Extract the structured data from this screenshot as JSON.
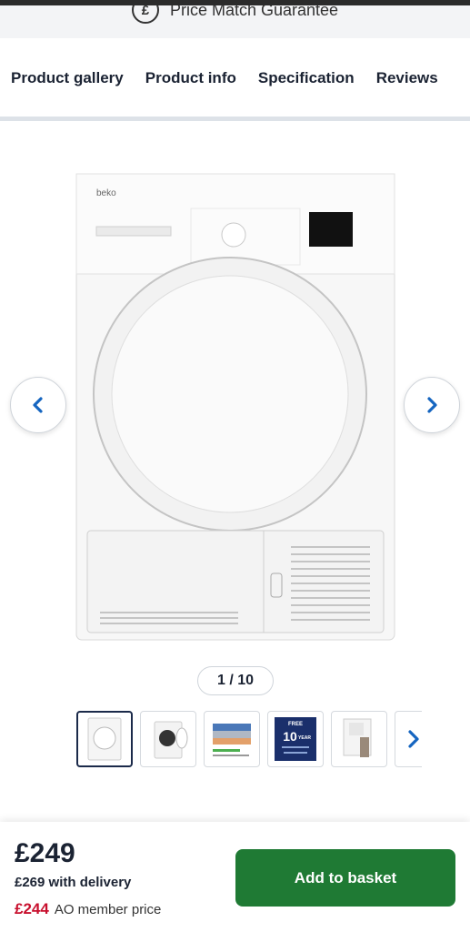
{
  "promo": {
    "text": "Price Match Guarantee",
    "icon": "pound-circle-icon"
  },
  "tabs": [
    {
      "label": "Product gallery"
    },
    {
      "label": "Product info"
    },
    {
      "label": "Specification"
    },
    {
      "label": "Reviews"
    }
  ],
  "gallery": {
    "brand_on_product": "beko",
    "counter": "1 / 10",
    "prev_icon": "chevron-left-icon",
    "next_icon": "chevron-right-icon",
    "thumbnails": [
      {
        "name": "thumb-front"
      },
      {
        "name": "thumb-door-open"
      },
      {
        "name": "thumb-clothes"
      },
      {
        "name": "thumb-warranty",
        "badge_top": "FREE",
        "badge_big": "10",
        "badge_sub": "YEAR"
      },
      {
        "name": "thumb-side"
      }
    ]
  },
  "purchase": {
    "price": "£249",
    "delivery_price": "£269 with delivery",
    "member_price": "£244",
    "member_label": "AO member price",
    "basket_label": "Add to basket"
  },
  "colors": {
    "accent_green": "#1f7a34",
    "nav_blue": "#1565c0",
    "member_red": "#c8102e"
  }
}
